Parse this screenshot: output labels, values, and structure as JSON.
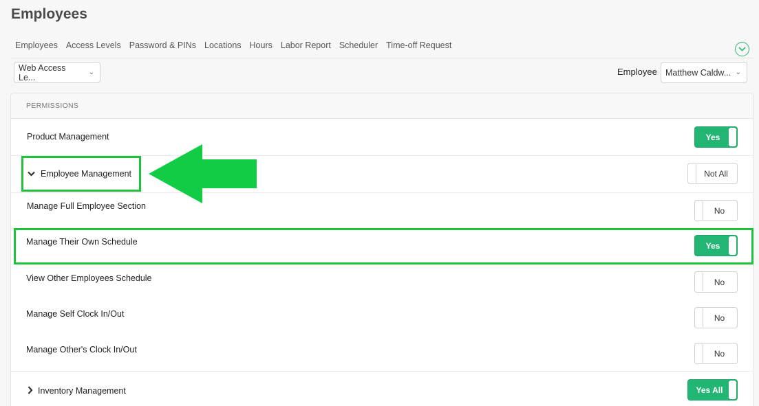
{
  "page": {
    "title": "Employees"
  },
  "tabs": [
    "Employees",
    "Access Levels",
    "Password & PINs",
    "Locations",
    "Hours",
    "Labor Report",
    "Scheduler",
    "Time-off Request"
  ],
  "filters": {
    "access_level": "Web Access Le...",
    "employee_label": "Employee",
    "employee": "Matthew Caldw..."
  },
  "permissions": {
    "header": "PERMISSIONS",
    "rows": [
      {
        "label": "Product Management",
        "toggle": "Yes",
        "on": true
      },
      {
        "label": "Employee Management",
        "toggle": "Not All",
        "on": false,
        "expanded": true
      },
      {
        "label": "Manage Full Employee Section",
        "toggle": "No",
        "on": false
      },
      {
        "label": "Manage Their Own Schedule",
        "toggle": "Yes",
        "on": true
      },
      {
        "label": "View Other Employees Schedule",
        "toggle": "No",
        "on": false
      },
      {
        "label": "Manage Self Clock In/Out",
        "toggle": "No",
        "on": false
      },
      {
        "label": "Manage Other's Clock In/Out",
        "toggle": "No",
        "on": false
      },
      {
        "label": "Inventory Management",
        "toggle": "Yes All",
        "on": true,
        "expanded": false
      }
    ]
  },
  "colors": {
    "accent": "#22b573",
    "highlight": "#1fc23b"
  }
}
